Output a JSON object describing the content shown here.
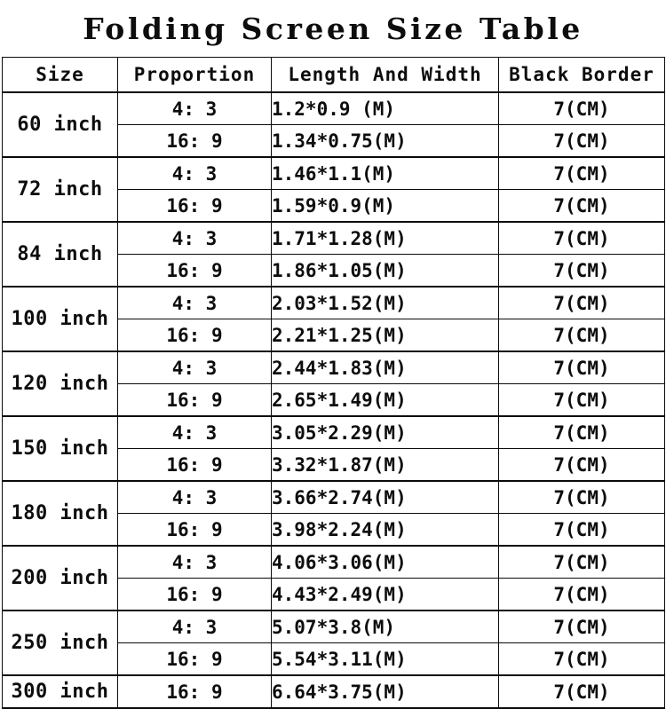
{
  "title": "Folding Screen Size Table",
  "table": {
    "columns": [
      {
        "key": "size",
        "label": "Size"
      },
      {
        "key": "prop",
        "label": "Proportion"
      },
      {
        "key": "lw",
        "label": "Length And Width"
      },
      {
        "key": "bb",
        "label": "Black Border"
      }
    ],
    "rows": [
      {
        "size": "60 inch",
        "entries": [
          {
            "prop": "4: 3",
            "lw": "1.2*0.9 (M)",
            "bb": "7(CM)"
          },
          {
            "prop": "16: 9",
            "lw": "1.34*0.75(M)",
            "bb": "7(CM)"
          }
        ]
      },
      {
        "size": "72 inch",
        "entries": [
          {
            "prop": "4: 3",
            "lw": "1.46*1.1(M)",
            "bb": "7(CM)"
          },
          {
            "prop": "16: 9",
            "lw": "1.59*0.9(M)",
            "bb": "7(CM)"
          }
        ]
      },
      {
        "size": "84 inch",
        "entries": [
          {
            "prop": "4: 3",
            "lw": "1.71*1.28(M)",
            "bb": "7(CM)"
          },
          {
            "prop": "16: 9",
            "lw": "1.86*1.05(M)",
            "bb": "7(CM)"
          }
        ]
      },
      {
        "size": "100 inch",
        "entries": [
          {
            "prop": "4: 3",
            "lw": "2.03*1.52(M)",
            "bb": "7(CM)"
          },
          {
            "prop": "16: 9",
            "lw": "2.21*1.25(M)",
            "bb": "7(CM)"
          }
        ]
      },
      {
        "size": "120 inch",
        "entries": [
          {
            "prop": "4: 3",
            "lw": "2.44*1.83(M)",
            "bb": "7(CM)"
          },
          {
            "prop": "16: 9",
            "lw": "2.65*1.49(M)",
            "bb": "7(CM)"
          }
        ]
      },
      {
        "size": "150 inch",
        "entries": [
          {
            "prop": "4: 3",
            "lw": "3.05*2.29(M)",
            "bb": "7(CM)"
          },
          {
            "prop": "16: 9",
            "lw": "3.32*1.87(M)",
            "bb": "7(CM)"
          }
        ]
      },
      {
        "size": "180 inch",
        "entries": [
          {
            "prop": "4: 3",
            "lw": "3.66*2.74(M)",
            "bb": "7(CM)"
          },
          {
            "prop": "16: 9",
            "lw": "3.98*2.24(M)",
            "bb": "7(CM)"
          }
        ]
      },
      {
        "size": "200 inch",
        "entries": [
          {
            "prop": "4: 3",
            "lw": "4.06*3.06(M)",
            "bb": "7(CM)"
          },
          {
            "prop": "16: 9",
            "lw": "4.43*2.49(M)",
            "bb": "7(CM)"
          }
        ]
      },
      {
        "size": "250 inch",
        "entries": [
          {
            "prop": "4: 3",
            "lw": "5.07*3.8(M)",
            "bb": "7(CM)"
          },
          {
            "prop": "16: 9",
            "lw": "5.54*3.11(M)",
            "bb": "7(CM)"
          }
        ]
      },
      {
        "size": "300 inch",
        "entries": [
          {
            "prop": "16: 9",
            "lw": "6.64*3.75(M)",
            "bb": "7(CM)"
          }
        ]
      }
    ]
  },
  "colors": {
    "background": "#ffffff",
    "text": "#0d0d0d",
    "border": "#0a0a0a"
  }
}
